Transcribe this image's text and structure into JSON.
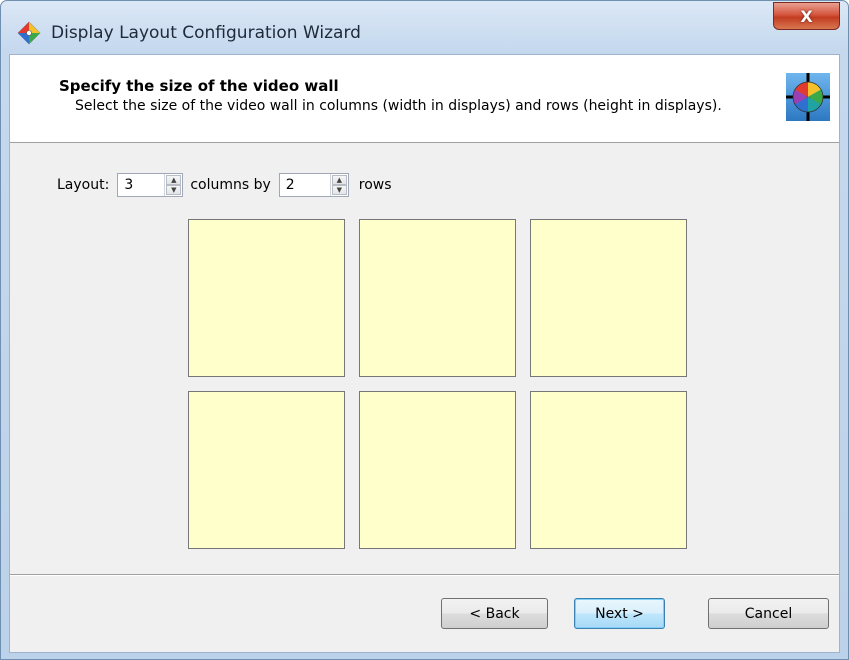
{
  "window": {
    "title": "Display Layout Configuration Wizard",
    "close_label": "X"
  },
  "header": {
    "title": "Specify the size of the video wall",
    "description": "Select the size of the video wall in columns (width in displays) and rows (height in displays)."
  },
  "layout": {
    "label": "Layout:",
    "columns_value": "3",
    "columns_suffix": "columns by",
    "rows_value": "2",
    "rows_suffix": "rows",
    "columns": 3,
    "rows": 2
  },
  "buttons": {
    "back": "< Back",
    "next": "Next >",
    "cancel": "Cancel"
  },
  "colors": {
    "display_fill": "#ffffcc",
    "title_bar": "#c5d8ee",
    "close_button": "#c23c22",
    "default_button": "#bee6fd"
  }
}
